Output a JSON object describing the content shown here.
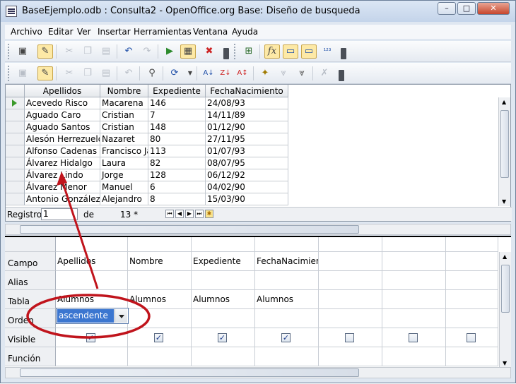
{
  "window": {
    "title": "BaseEjemplo.odb : Consulta2 - OpenOffice.org Base: Diseño de busqueda",
    "minimize": "–",
    "maximize": "□",
    "close": "✕"
  },
  "menu": [
    "Archivo",
    "Editar",
    "Ver",
    "Insertar",
    "Herramientas",
    "Ventana",
    "Ayuda"
  ],
  "table": {
    "columns": [
      "Apellidos",
      "Nombre",
      "Expediente",
      "FechaNacimiento"
    ],
    "rows": [
      [
        "Acevedo Risco",
        "Macarena",
        "146",
        "24/08/93"
      ],
      [
        "Aguado Caro",
        "Cristian",
        "7",
        "14/11/89"
      ],
      [
        "Aguado Santos",
        "Cristian",
        "148",
        "01/12/90"
      ],
      [
        "Alesón Herrezuelo",
        "Nazaret",
        "80",
        "27/11/95"
      ],
      [
        "Alfonso Cadenas",
        "Francisco Ja",
        "113",
        "01/07/93"
      ],
      [
        "Álvarez Hidalgo",
        "Laura",
        "82",
        "08/07/95"
      ],
      [
        "Álvarez Lindo",
        "Jorge",
        "128",
        "06/12/92"
      ],
      [
        "Álvarez Menor",
        "Manuel",
        "6",
        "04/02/90"
      ],
      [
        "Antonio González",
        "Alejandro",
        "8",
        "15/03/90"
      ]
    ]
  },
  "nav": {
    "registro_label": "Registro",
    "record": "1",
    "de_label": "de",
    "total": "13 *"
  },
  "design": {
    "labels": [
      "Campo",
      "Alias",
      "Tabla",
      "Orden",
      "Visible",
      "Función"
    ],
    "fields": [
      "Apellidos",
      "Nombre",
      "Expediente",
      "FechaNacimient"
    ],
    "tables": [
      "Alumnos",
      "Alumnos",
      "Alumnos",
      "Alumnos"
    ],
    "order_value": "ascendente",
    "check": "✓"
  },
  "colors": {
    "annotation": "#c0141c",
    "selection": "#3b76d0"
  }
}
